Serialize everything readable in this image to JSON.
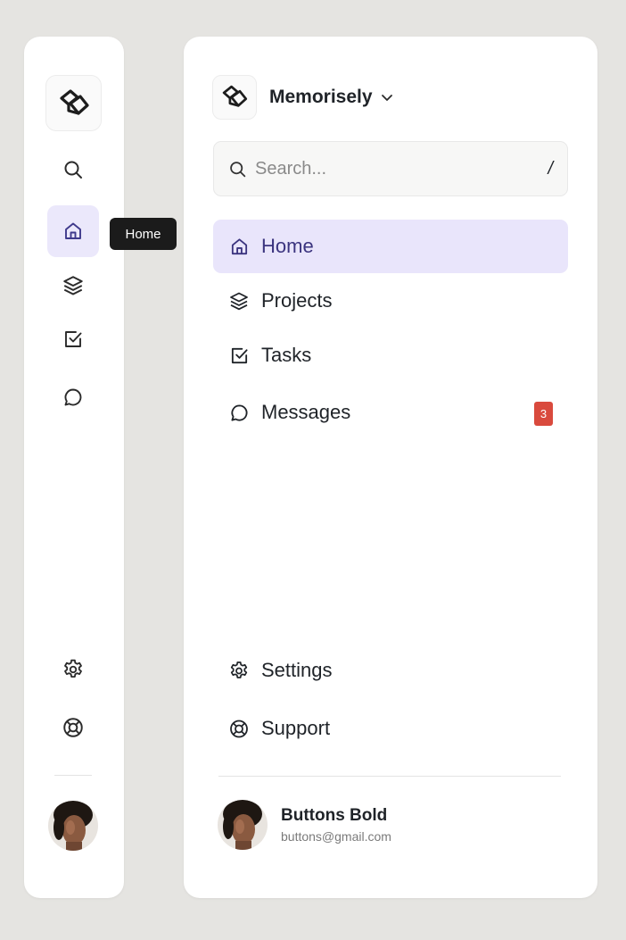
{
  "tooltip": {
    "text": "Home"
  },
  "workspace": {
    "name": "Memorisely"
  },
  "search": {
    "placeholder": "Search...",
    "shortcut": "/"
  },
  "nav": {
    "home": "Home",
    "projects": "Projects",
    "tasks": "Tasks",
    "messages": "Messages",
    "messages_badge": "3",
    "settings": "Settings",
    "support": "Support"
  },
  "user": {
    "name": "Buttons Bold",
    "email": "buttons@gmail.com"
  },
  "colors": {
    "accent_bg": "#e9e5fb",
    "accent_text": "#3b347f",
    "badge": "#d94a3d",
    "tooltip_bg": "#1b1b1b"
  },
  "icons": [
    "logo-icon",
    "search-icon",
    "home-icon",
    "layers-icon",
    "checkbox-icon",
    "chat-icon",
    "gear-icon",
    "lifebuoy-icon",
    "chevron-down-icon"
  ]
}
